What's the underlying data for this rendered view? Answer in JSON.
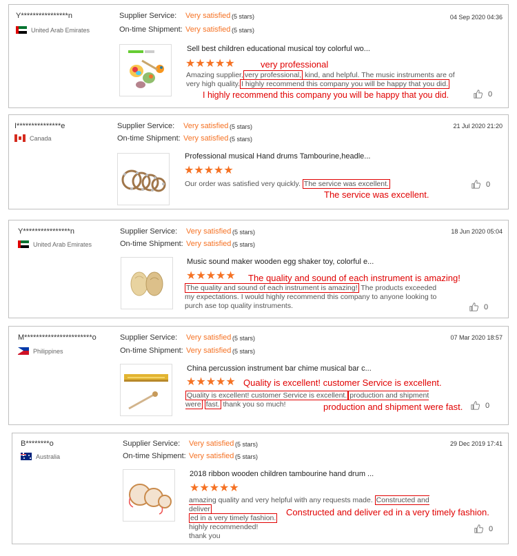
{
  "labels": {
    "supplier_service": "Supplier Service:",
    "ontime_shipment": "On-time Shipment:"
  },
  "reviews": [
    {
      "user": "Y****************n",
      "country": "United Arab Emirates",
      "flag": "uae",
      "supplier_value": "Very satisfied",
      "supplier_stars": "(5 stars)",
      "shipment_value": "Very satisfied",
      "shipment_stars": "(5 stars)",
      "date": "04 Sep 2020 04:36",
      "product_title": "Sell best children educational musical toy colorful wo...",
      "stars": "★★★★★",
      "text_parts": [
        "Amazing supplier,",
        "very professional,",
        " kind, and helpful. The music instruments are of very high quality.",
        "I highly recommend this company you will be happy that you did.",
        ""
      ],
      "annotation_1": "very professional",
      "annotation_2": "I highly recommend this company you will be happy that you did.",
      "likes": "0"
    },
    {
      "user": "I***************e",
      "country": "Canada",
      "flag": "canada",
      "supplier_value": "Very satisfied",
      "supplier_stars": "(5 stars)",
      "shipment_value": "Very satisfied",
      "shipment_stars": "(5 stars)",
      "date": "21 Jul 2020 21:20",
      "product_title": "Professional musical Hand drums Tambourine,headle...",
      "stars": "★★★★★",
      "text_parts": [
        "Our order was satisfied very quickly.",
        "The service was excellent."
      ],
      "annotation_1": "The service was excellent.",
      "likes": "0"
    },
    {
      "user": "Y****************n",
      "country": "United Arab Emirates",
      "flag": "uae",
      "supplier_value": "Very satisfied",
      "supplier_stars": "(5 stars)",
      "shipment_value": "Very satisfied",
      "shipment_stars": "(5 stars)",
      "date": "18 Jun 2020 05:04",
      "product_title": "Music sound maker wooden egg shaker toy, colorful e...",
      "stars": "★★★★★",
      "text_parts": [
        "The quality and sound of each instrument is amazing!",
        " The products exceeded my expectations. I would highly recommend this company to anyone looking to purch ase top quality instruments."
      ],
      "annotation_1": "The quality and sound of each instrument is amazing!",
      "likes": "0"
    },
    {
      "user": "M***********************o",
      "country": "Philippines",
      "flag": "philippines",
      "supplier_value": "Very satisfied",
      "supplier_stars": "(5 stars)",
      "shipment_value": "Very satisfied",
      "shipment_stars": "(5 stars)",
      "date": "07 Mar 2020 18:57",
      "product_title": "China percussion instrument bar chime musical bar c...",
      "stars": "★★★★★",
      "text_parts": [
        "Quality is excellent! customer Service is excellent.",
        "production and shipment were",
        "fast.",
        " thank you so much!"
      ],
      "annotation_1": "Quality is excellent!  customer Service is excellent.",
      "annotation_2": "production and shipment were fast.",
      "likes": "0"
    },
    {
      "user": "B********o",
      "country": "Australia",
      "flag": "australia",
      "supplier_value": "Very satisfied",
      "supplier_stars": "(5 stars)",
      "shipment_value": "Very satisfied",
      "shipment_stars": "(5 stars)",
      "date": "29 Dec 2019 17:41",
      "product_title": "2018 ribbon wooden children tambourine hand drum ...",
      "stars": "★★★★★",
      "text_parts": [
        "amazing quality and very helpful with any requests made.",
        "Constructed and deliver",
        "ed in a very timely fashion.",
        "highly recommended!",
        "thank you"
      ],
      "annotation_1": "Constructed and deliver ed in a very timely fashion.",
      "likes": "0"
    }
  ]
}
